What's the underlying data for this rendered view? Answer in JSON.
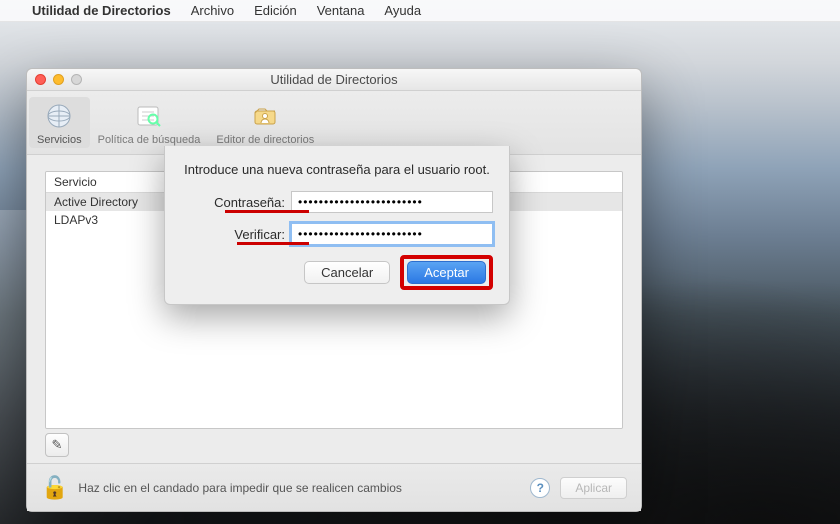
{
  "menubar": {
    "app_name": "Utilidad de Directorios",
    "items": [
      "Archivo",
      "Edición",
      "Ventana",
      "Ayuda"
    ]
  },
  "window": {
    "title": "Utilidad de Directorios",
    "toolbar": {
      "services": "Servicios",
      "search_policy": "Política de búsqueda",
      "dir_editor": "Editor de directorios"
    },
    "table": {
      "header": "Servicio",
      "rows": [
        "Active Directory",
        "LDAPv3"
      ]
    },
    "edit_button": "✎",
    "footer": {
      "lock_icon": "🔓",
      "text": "Haz clic en el candado para impedir que se realicen cambios",
      "help": "?",
      "apply": "Aplicar"
    }
  },
  "sheet": {
    "prompt": "Introduce una nueva contraseña para el usuario root.",
    "password_label": "Contraseña:",
    "verify_label": "Verificar:",
    "password_value": "••••••••••••••••••••••••",
    "verify_value": "••••••••••••••••••••••••",
    "cancel": "Cancelar",
    "accept": "Aceptar"
  },
  "colors": {
    "highlight_red": "#d30000",
    "primary_blue": "#2b78e4"
  }
}
